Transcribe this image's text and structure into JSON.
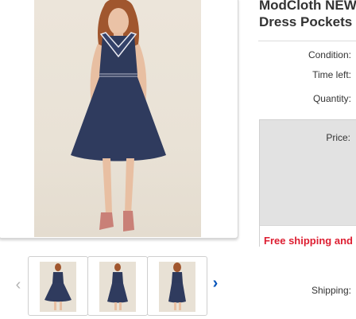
{
  "listing": {
    "title_line1": "ModCloth NEW",
    "title_line2": "Dress Pockets"
  },
  "details": {
    "condition_label": "Condition:",
    "time_left_label": "Time left:",
    "quantity_label": "Quantity:",
    "price_label": "Price:",
    "free_shipping_text": "Free shipping and",
    "shipping_label": "Shipping:"
  },
  "gallery": {
    "prev_icon": "chevron-left-icon",
    "next_icon": "chevron-right-icon",
    "accent_color": "#0654ba"
  },
  "colors": {
    "free_shipping": "#dd1e31",
    "price_box": "#e2e2e2"
  }
}
